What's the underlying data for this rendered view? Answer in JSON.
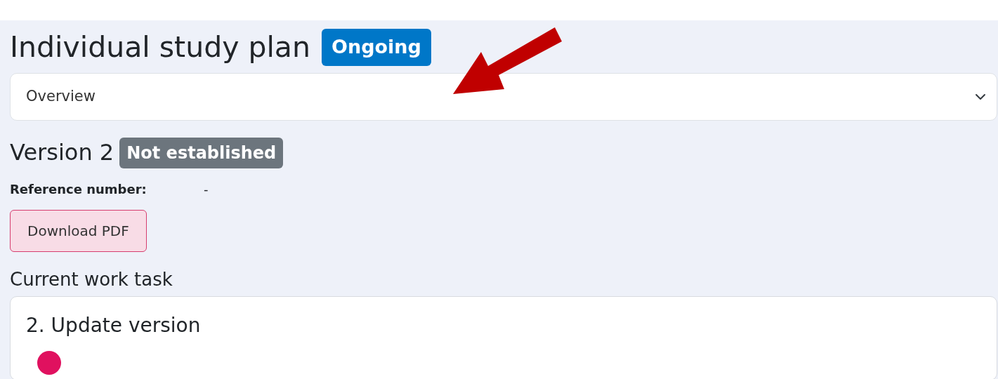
{
  "page": {
    "title": "Individual study plan",
    "status_badge": "Ongoing"
  },
  "view_select": {
    "value": "Overview"
  },
  "version": {
    "title": "Version 2",
    "status_badge": "Not established",
    "reference_label": "Reference number:",
    "reference_value": "-",
    "download_button": "Download PDF"
  },
  "current_task": {
    "heading": "Current work task",
    "card_title": "2. Update version"
  }
}
